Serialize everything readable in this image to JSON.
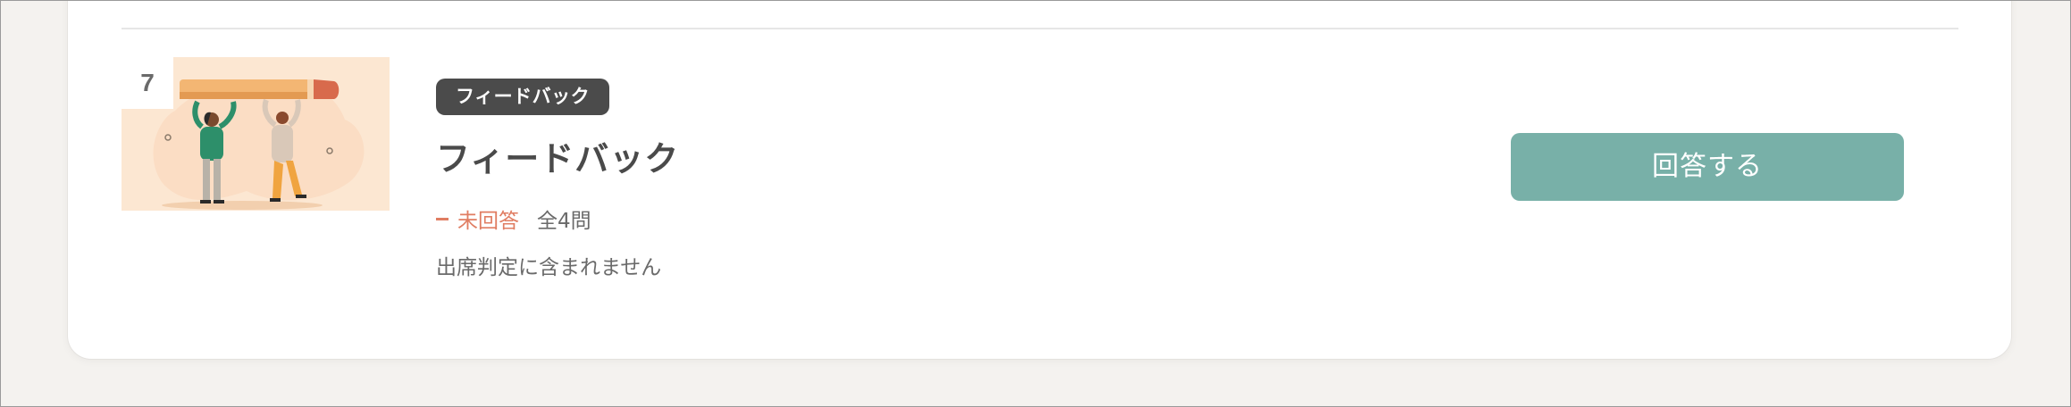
{
  "item": {
    "number": "7",
    "tag": "フィードバック",
    "title": "フィードバック",
    "status_label": "未回答",
    "question_count": "全4問",
    "note": "出席判定に含まれません",
    "answer_button_label": "回答する"
  },
  "colors": {
    "status": "#e07d62",
    "button": "#78b0a8",
    "tag_bg": "#4b4b4b",
    "thumb_bg": "#fce7d2"
  },
  "icons": {
    "thumbnail": "people-carrying-pencil-illustration"
  }
}
